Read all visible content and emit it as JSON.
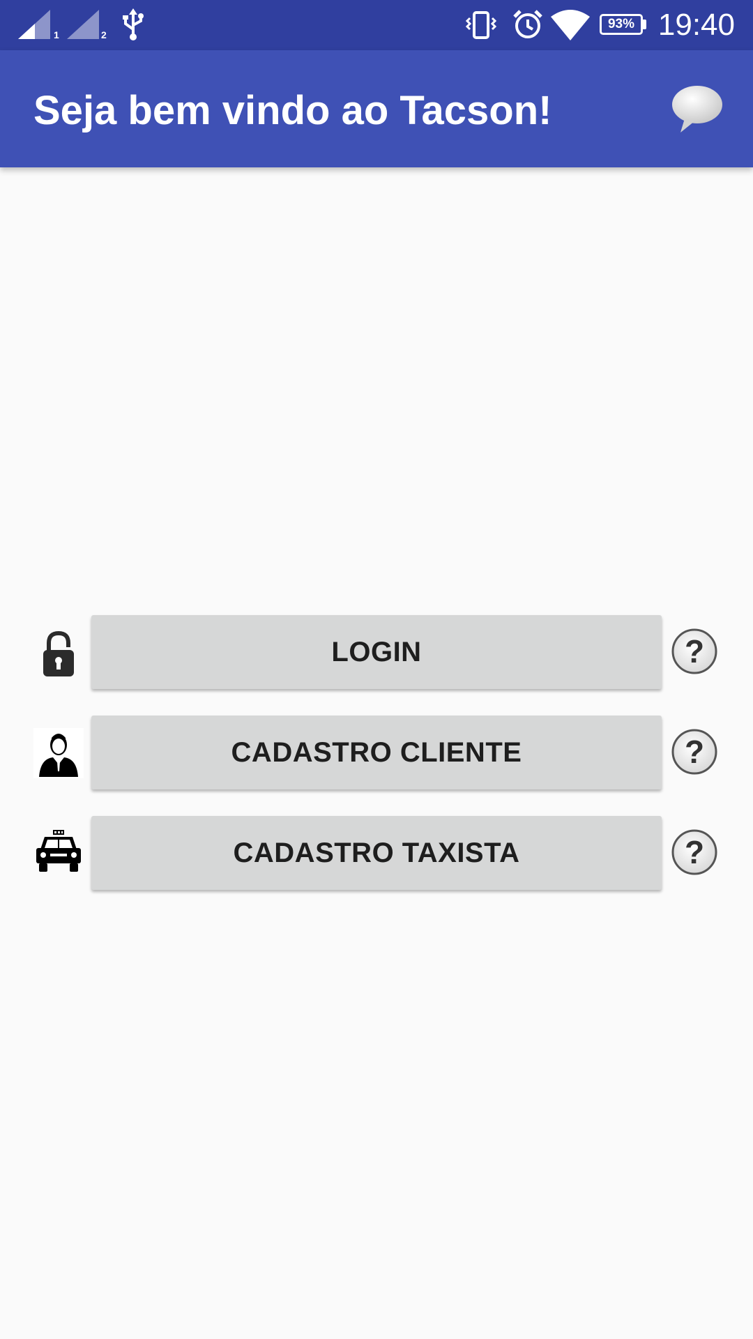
{
  "status_bar": {
    "sim1_label": "1",
    "sim2_label": "2",
    "battery": "93%",
    "time": "19:40"
  },
  "app_bar": {
    "title": "Seja bem vindo ao Tacson!"
  },
  "actions": {
    "login_label": "LOGIN",
    "client_signup_label": "CADASTRO CLIENTE",
    "driver_signup_label": "CADASTRO TAXISTA"
  },
  "colors": {
    "status_bar": "#303f9f",
    "app_bar": "#3f51b5",
    "background": "#fafafa",
    "button": "#d6d7d7"
  },
  "icons": {
    "chat": "chat-bubble-icon",
    "login": "padlock-icon",
    "client": "businessman-icon",
    "driver": "taxi-icon",
    "help": "question-mark-icon"
  }
}
